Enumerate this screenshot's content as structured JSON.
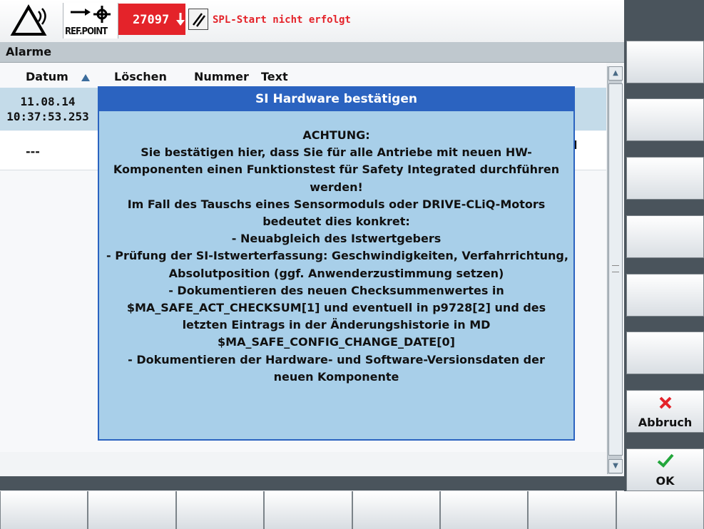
{
  "status": {
    "ref_point_label": "REF.POINT",
    "alarm_number": "27097",
    "alarm_text": "SPL-Start nicht erfolgt",
    "alarm_color": "#e4232a"
  },
  "panel": {
    "title": "Alarme"
  },
  "table": {
    "columns": [
      "Datum",
      "Löschen",
      "Nummer",
      "Text"
    ],
    "rows": [
      {
        "date": "11.08.14",
        "time": "10:37:53.253"
      },
      {
        "date": "---",
        "text_tail": "d"
      }
    ]
  },
  "dialog": {
    "title": "SI Hardware bestätigen",
    "lines": [
      "ACHTUNG:",
      "Sie bestätigen hier, dass Sie für alle Antriebe mit neuen HW-",
      "Komponenten einen Funktionstest für Safety Integrated durchführen",
      "werden!",
      "Im Fall des Tauschs eines Sensormoduls oder DRIVE-CLiQ-Motors",
      "bedeutet dies konkret:",
      "- Neuabgleich des Istwertgebers",
      "- Prüfung der SI-Istwerterfassung: Geschwindigkeiten, Verfahrrichtung,",
      "Absolutposition (ggf. Anwenderzustimmung setzen)",
      "- Dokumentieren des neuen Checksummenwertes in",
      "$MA_SAFE_ACT_CHECKSUM[1] und eventuell in p9728[2] und des",
      "letzten Eintrags in der Änderungshistorie in MD",
      "$MA_SAFE_CONFIG_CHANGE_DATE[0]",
      "- Dokumentieren der Hardware- und Software-Versionsdaten der",
      "neuen Komponente"
    ]
  },
  "softkeys": {
    "cancel_label": "Abbruch",
    "ok_label": "OK"
  },
  "colors": {
    "dialog_bg": "#a8cfe9",
    "dialog_title": "#2b63c0",
    "cancel_icon": "#e4232a",
    "ok_icon": "#22a63b"
  }
}
